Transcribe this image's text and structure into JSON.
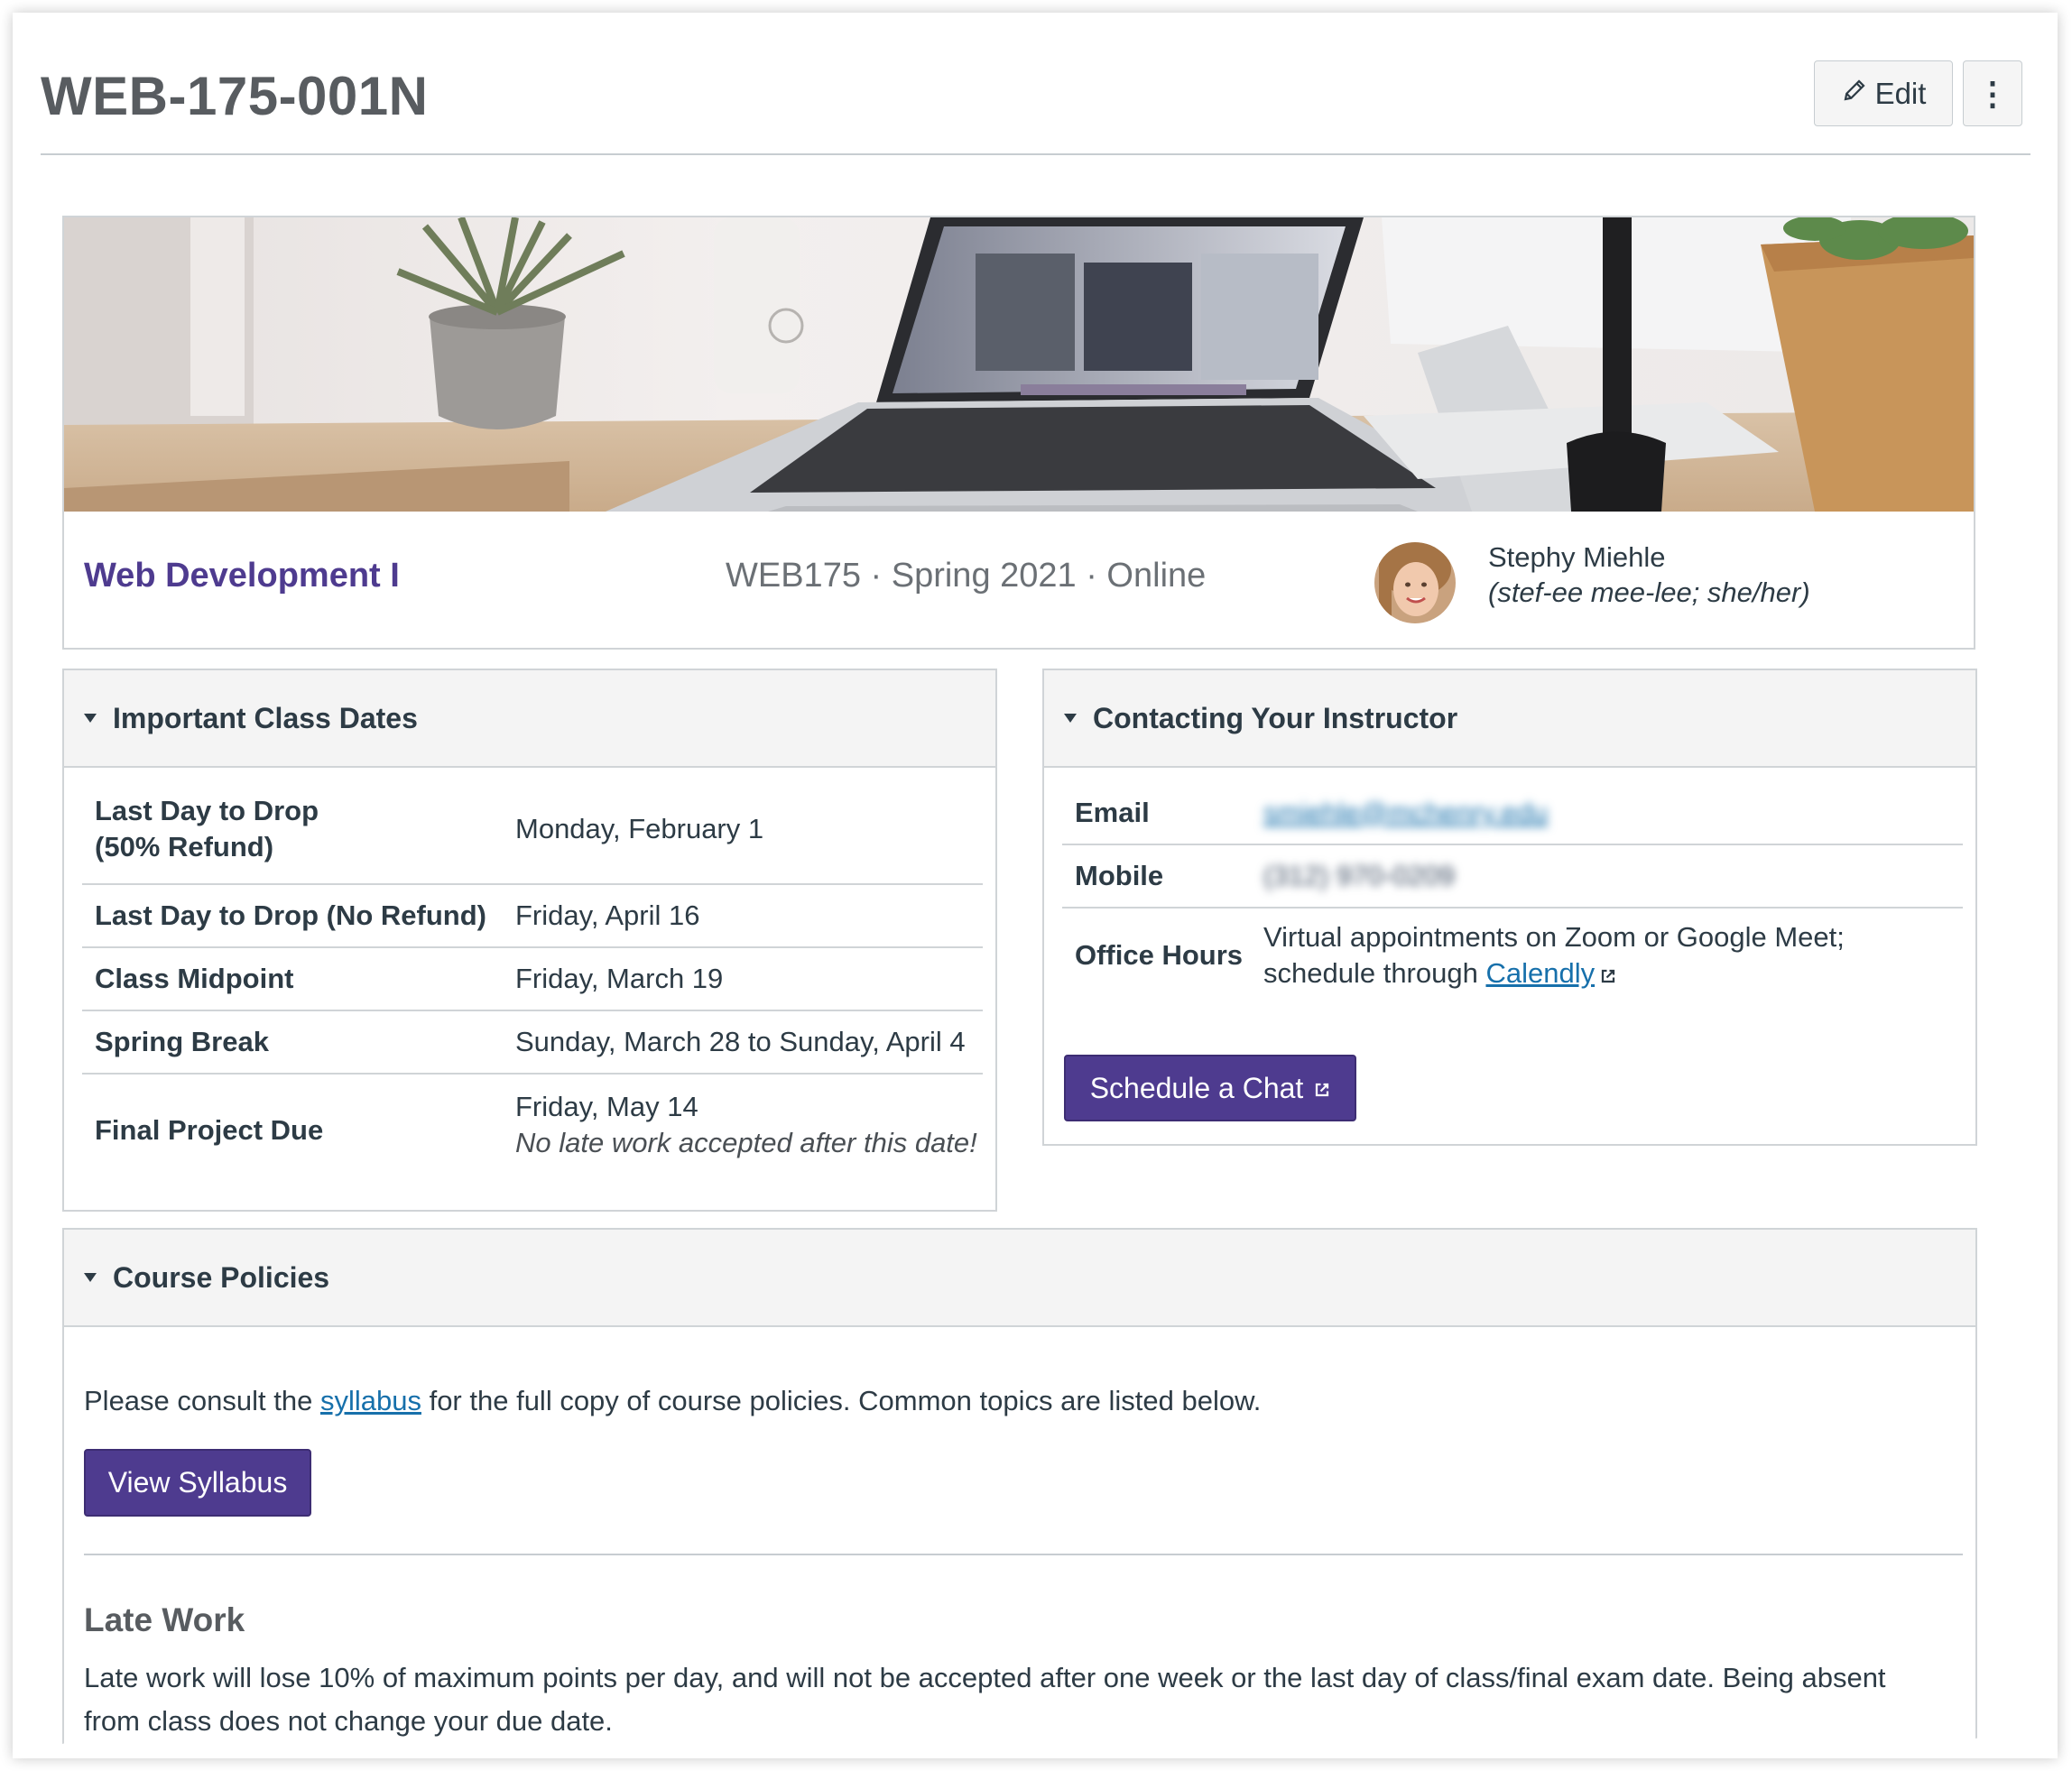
{
  "header": {
    "title": "WEB-175-001N",
    "edit_label": "Edit",
    "more_label": "⋮"
  },
  "banner": {
    "course_name": "Web Development I",
    "course_meta": "WEB175 · Spring 2021 · Online",
    "instructor_name": "Stephy Miehle",
    "instructor_pronunciation": "(stef-ee mee-lee; she/her)"
  },
  "class_dates": {
    "title": "Important Class Dates",
    "rows": [
      {
        "label_line1": "Last Day to Drop",
        "label_line2": "(50% Refund)",
        "value": "Monday, February 1"
      },
      {
        "label": "Last Day to Drop (No Refund)",
        "value": "Friday, April 16"
      },
      {
        "label": "Class Midpoint",
        "value": "Friday, March 19"
      },
      {
        "label": "Spring Break",
        "value": "Sunday, March 28 to Sunday, April 4"
      },
      {
        "label": "Final Project Due",
        "value": "Friday, May 14",
        "note": "No late work accepted after this date!"
      }
    ]
  },
  "contact": {
    "title": "Contacting Your Instructor",
    "email_label": "Email",
    "email_value": "smiehle@mchenry.edu",
    "mobile_label": "Mobile",
    "mobile_value": "(312) 970-0209",
    "office_label": "Office Hours",
    "office_line1": "Virtual appointments on Zoom or Google Meet;",
    "office_line2_prefix": "schedule through",
    "office_link": "Calendly",
    "schedule_button": "Schedule a Chat"
  },
  "policies": {
    "title": "Course Policies",
    "intro_prefix": "Please consult the",
    "intro_link": "syllabus",
    "intro_suffix": "for the full copy of course policies. Common topics are listed below.",
    "view_button": "View Syllabus",
    "late_heading": "Late Work",
    "late_line1": "Late work will lose 10% of maximum points per day, and will not be accepted after one week or the last day of class/final exam date. Being absent",
    "late_line2": "from class does not change your due date."
  },
  "colors": {
    "accent": "#4e3b8f",
    "link": "#1770ab",
    "text": "#2d3b45"
  }
}
